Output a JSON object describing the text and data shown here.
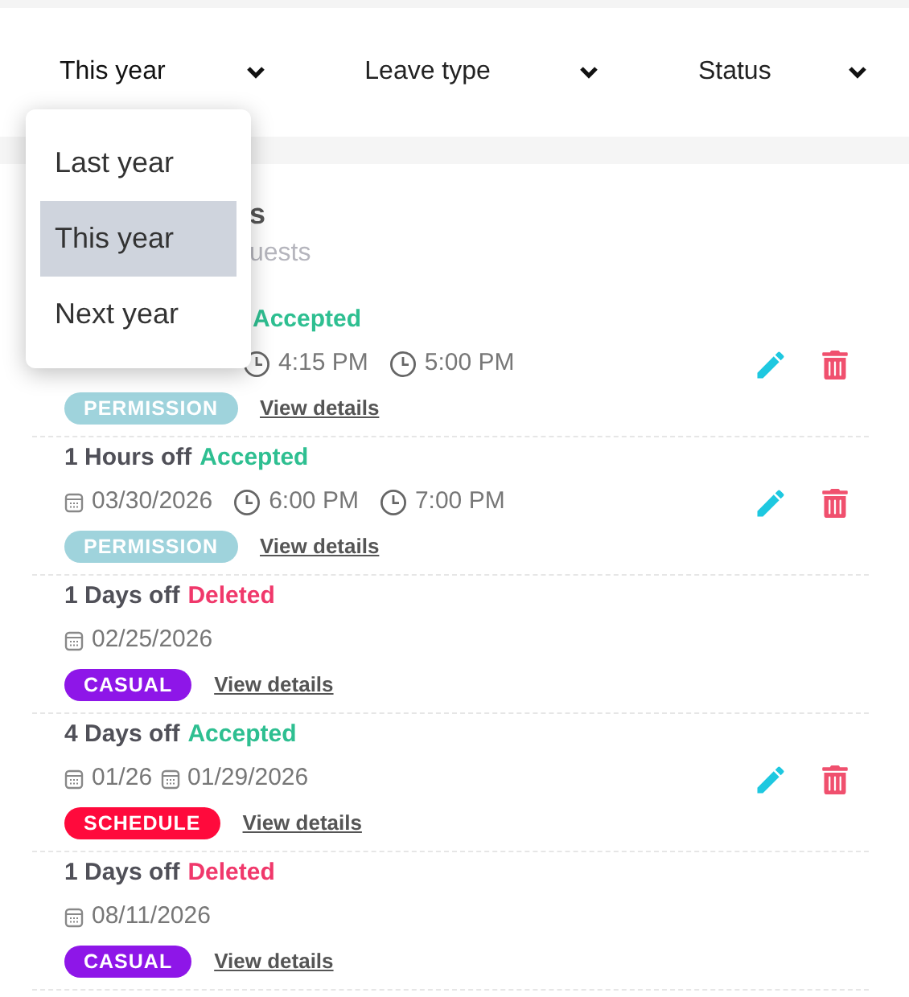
{
  "filters": [
    {
      "label": "This year",
      "open": true
    },
    {
      "label": "Leave type",
      "open": false
    },
    {
      "label": "Status",
      "open": false
    }
  ],
  "year_menu": [
    {
      "label": "Last year",
      "selected": false
    },
    {
      "label": "This year",
      "selected": true
    },
    {
      "label": "Next year",
      "selected": false
    }
  ],
  "card": {
    "title": "s",
    "subtitle": "uests"
  },
  "requests": [
    {
      "status": {
        "text": "Accepted",
        "color": "#2ebf91"
      },
      "times": [
        "4:15 PM",
        "5:00 PM"
      ],
      "tag": {
        "text": "PERMISSION",
        "color": "#9fd3dc"
      },
      "link": "View details",
      "actions": true
    },
    {
      "duration": "1 Hours off",
      "status": {
        "text": "Accepted",
        "color": "#2ebf91"
      },
      "date": "03/30/2026",
      "times": [
        "6:00 PM",
        "7:00 PM"
      ],
      "tag": {
        "text": "PERMISSION",
        "color": "#9fd3dc"
      },
      "link": "View details",
      "actions": true
    },
    {
      "duration": "1 Days off",
      "status": {
        "text": "Deleted",
        "color": "#f0386b"
      },
      "date": "02/25/2026",
      "tag": {
        "text": "CASUAL",
        "color": "#8e16e8"
      },
      "link": "View details",
      "actions": false
    },
    {
      "duration": "4 Days off",
      "status": {
        "text": "Accepted",
        "color": "#2ebf91"
      },
      "date_from": "01/26",
      "date": "01/29/2026",
      "tag": {
        "text": "SCHEDULE",
        "color": "#ff0a3c"
      },
      "link": "View details",
      "actions": true
    },
    {
      "duration": "1 Days off",
      "status": {
        "text": "Deleted",
        "color": "#f0386b"
      },
      "date": "08/11/2026",
      "tag": {
        "text": "CASUAL",
        "color": "#8e16e8"
      },
      "link": "View details",
      "actions": false
    }
  ]
}
